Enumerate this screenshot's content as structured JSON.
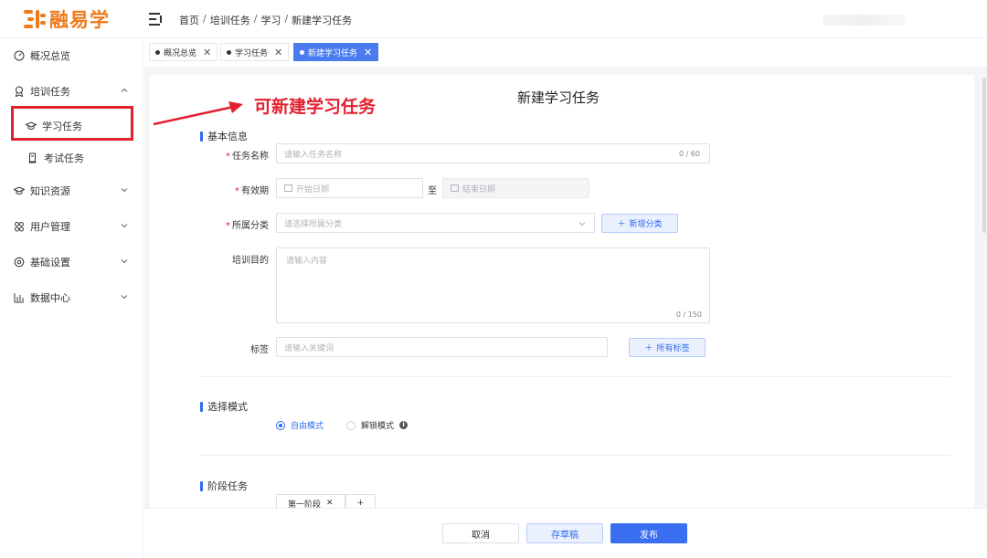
{
  "app": {
    "brand_name": "融易学",
    "brand_color": "#ee7a1a",
    "accent_color": "#2f6bf0",
    "annotation_color": "#e2202e"
  },
  "header": {
    "breadcrumb": [
      "首页",
      "培训任务",
      "学习",
      "新建学习任务"
    ],
    "breadcrumb_sep": "/"
  },
  "sidebar": {
    "items": [
      {
        "label": "概况总览",
        "icon": "dashboard-icon"
      },
      {
        "label": "培训任务",
        "icon": "award-icon",
        "expanded": true
      },
      {
        "label": "学习任务",
        "icon": "graduation-cap-icon",
        "sub": true,
        "active": true
      },
      {
        "label": "考试任务",
        "icon": "exam-doc-icon",
        "sub": true
      },
      {
        "label": "知识资源",
        "icon": "graduation-cap-icon"
      },
      {
        "label": "用户管理",
        "icon": "users-icon"
      },
      {
        "label": "基础设置",
        "icon": "settings-icon"
      },
      {
        "label": "数据中心",
        "icon": "bar-chart-icon"
      }
    ]
  },
  "tabs": [
    {
      "label": "概况总览",
      "active": false
    },
    {
      "label": "学习任务",
      "active": false
    },
    {
      "label": "新建学习任务",
      "active": true
    }
  ],
  "page": {
    "title": "新建学习任务",
    "annotation": "可新建学习任务"
  },
  "form": {
    "basic_section": "基本信息",
    "task_name": {
      "label": "任务名称",
      "placeholder": "请输入任务名称",
      "counter": "0 / 60"
    },
    "validity": {
      "label": "有效期",
      "start_placeholder": "开始日期",
      "to": "至",
      "end_placeholder": "结束日期"
    },
    "category": {
      "label": "所属分类",
      "placeholder": "请选择所属分类",
      "add_label": "新增分类"
    },
    "purpose": {
      "label": "培训目的",
      "placeholder": "请输入内容",
      "counter": "0 / 150"
    },
    "tags": {
      "label": "标签",
      "placeholder": "请输入关键词",
      "all_tags_label": "所有标签"
    },
    "mode_section": "选择模式",
    "modes": [
      {
        "label": "自由模式",
        "checked": true
      },
      {
        "label": "解锁模式",
        "checked": false
      }
    ],
    "stage_section": "阶段任务",
    "stage_tabs": [
      "第一阶段",
      "+"
    ]
  },
  "footer": {
    "cancel": "取消",
    "draft": "存草稿",
    "publish": "发布"
  }
}
